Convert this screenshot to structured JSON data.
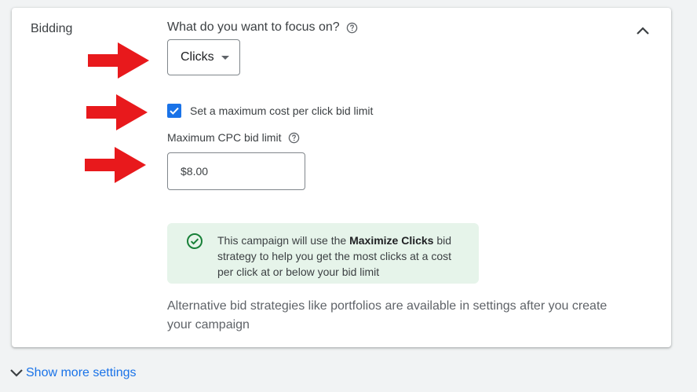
{
  "section": {
    "label": "Bidding"
  },
  "focus": {
    "question": "What do you want to focus on?",
    "selected": "Clicks"
  },
  "max_cpc": {
    "checkbox_label": "Set a maximum cost per click bid limit",
    "checked": true,
    "field_label": "Maximum CPC bid limit",
    "currency": "$",
    "value": "8.00"
  },
  "info": {
    "text_before": "This campaign will use the ",
    "strategy_name": "Maximize Clicks",
    "text_after": " bid strategy to help you get the most clicks at a cost per click at or below your bid limit"
  },
  "alternative_note": "Alternative bid strategies like portfolios are available in settings after you create your campaign",
  "show_more_label": "Show more settings",
  "colors": {
    "accent": "#1a73e8",
    "annotation_arrow": "#e8191c",
    "success": "#188038",
    "info_background": "#e6f4ea"
  },
  "icons": {
    "collapse": "chevron-up-icon",
    "help": "help-circle-icon",
    "checkbox": "checkmark-icon",
    "info": "check-circle-icon",
    "show_more": "chevron-down-icon",
    "annotation": "red-arrow-icon"
  }
}
